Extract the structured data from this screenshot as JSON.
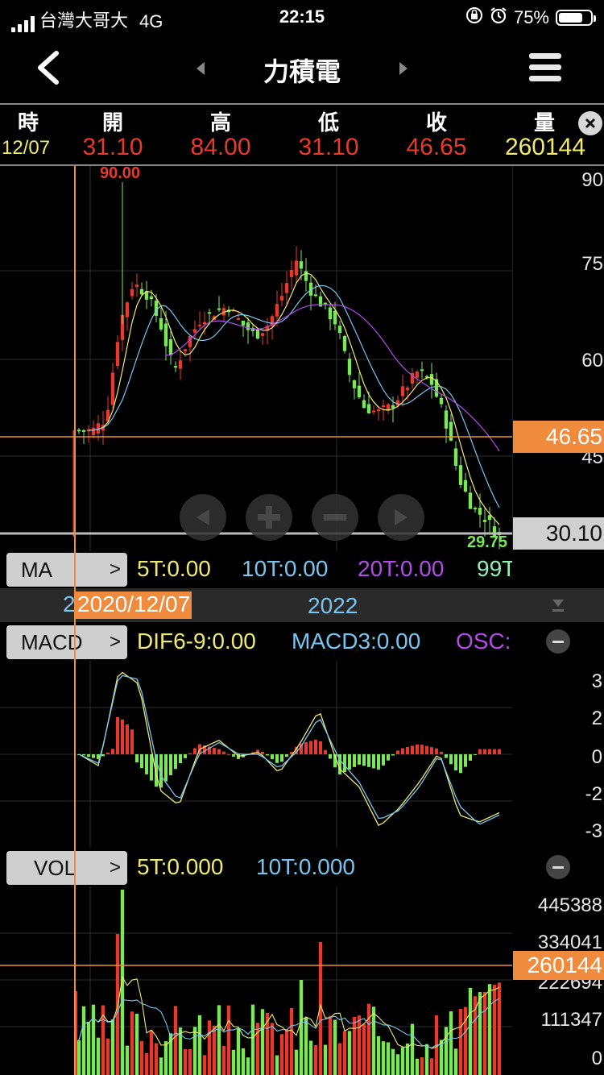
{
  "status_bar": {
    "carrier": "台灣大哥大",
    "network": "4G",
    "time": "22:15",
    "battery": "75%"
  },
  "nav": {
    "title": "力積電"
  },
  "quote": {
    "headers": [
      "時",
      "開",
      "高",
      "低",
      "收",
      "量"
    ],
    "date": "12/07",
    "open": "31.10",
    "high": "84.00",
    "low": "31.10",
    "close": "46.65",
    "volume": "260144"
  },
  "price_chart": {
    "high_marker": "90.00",
    "low_marker": "29.75",
    "y_ticks": [
      "90",
      "75",
      "60",
      "45"
    ],
    "current_price": "46.65",
    "crosshair_price": "30.10"
  },
  "ma_bar": {
    "button": "MA",
    "ma5": "5T:0.00",
    "ma10": "10T:0.00",
    "ma20": "20T:0.00",
    "ma99": "99T"
  },
  "time_axis": {
    "selected_date": "2020/12/07",
    "prefix": "2",
    "year_label": "2022"
  },
  "macd": {
    "button": "MACD",
    "dif": "DIF6-9:0.00",
    "macd": "MACD3:0.00",
    "osc": "OSC:",
    "y_ticks": [
      "3",
      "2",
      "0",
      "-2",
      "-3"
    ]
  },
  "vol": {
    "button": "VOL",
    "ma5": "5T:0.000",
    "ma10": "10T:0.000",
    "y_ticks": [
      "445388",
      "334041",
      "222694",
      "111347",
      "0"
    ],
    "crosshair_value": "260144"
  },
  "colors": {
    "up": "#e8392c",
    "down": "#7be85a",
    "accent": "#f08a3c",
    "ma5": "#f0ea6e",
    "ma10": "#78c6f0",
    "ma20": "#b04ce8",
    "ma99": "#90f0b8"
  },
  "chart_data": {
    "type": "candlestick",
    "x_label_visible": "2022",
    "price_range": [
      29.75,
      90.0
    ],
    "current_price": 46.65,
    "volume_range": [
      0,
      445388
    ]
  }
}
